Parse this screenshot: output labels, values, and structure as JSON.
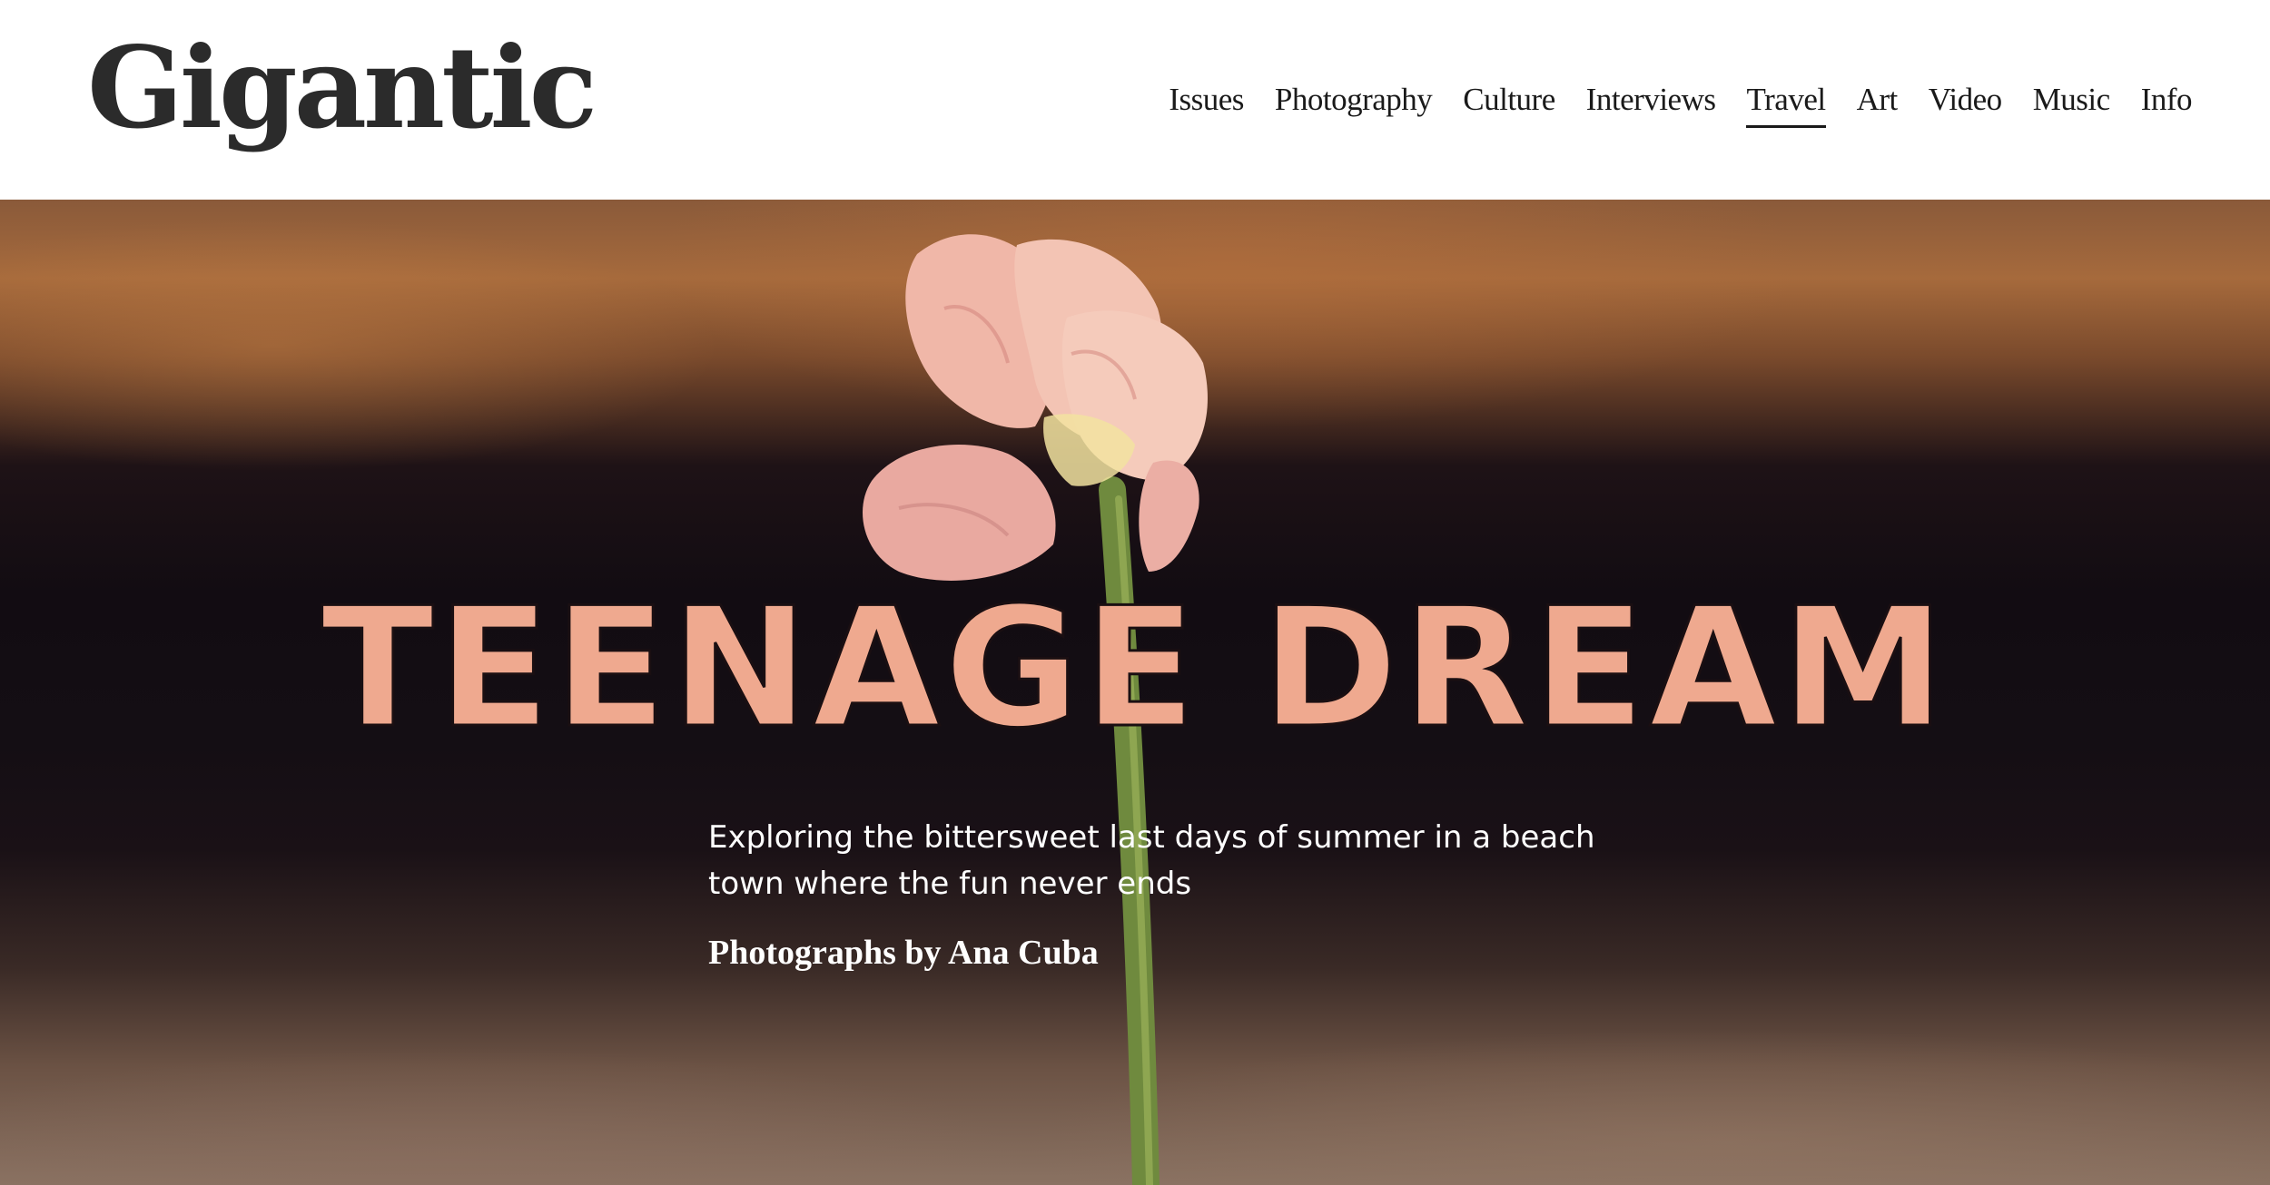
{
  "site": {
    "logo_text": "Gigantic"
  },
  "nav": {
    "items": [
      {
        "label": "Issues",
        "active": false
      },
      {
        "label": "Photography",
        "active": false
      },
      {
        "label": "Culture",
        "active": false
      },
      {
        "label": "Interviews",
        "active": false
      },
      {
        "label": "Travel",
        "active": true
      },
      {
        "label": "Art",
        "active": false
      },
      {
        "label": "Video",
        "active": false
      },
      {
        "label": "Music",
        "active": false
      },
      {
        "label": "Info",
        "active": false
      }
    ]
  },
  "hero": {
    "title": "TEENAGE DREAM",
    "subtitle": "Exploring the bittersweet last days of summer in a beach town where the fun never ends",
    "credit": "Photographs by Ana Cuba",
    "title_color": "#efa98f"
  }
}
